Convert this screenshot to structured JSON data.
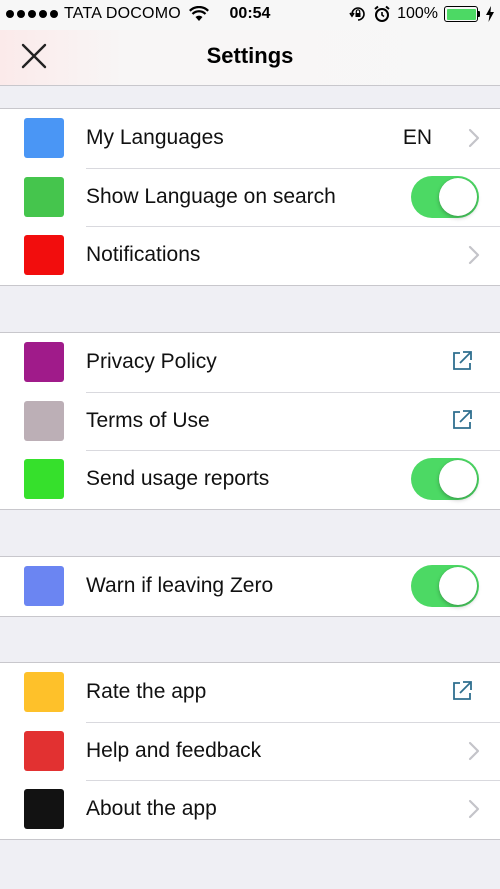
{
  "status_bar": {
    "carrier": "TATA DOCOMO",
    "time": "00:54",
    "battery": "100%",
    "battery_level": 1.0
  },
  "nav": {
    "title": "Settings"
  },
  "colors": {
    "toggle_on": "#4cd964",
    "link_icon": "#2f6f8f"
  },
  "groups": [
    {
      "items": [
        {
          "label": "My Languages",
          "color": "#4a96f5",
          "accessory": "chevron",
          "value": "EN"
        },
        {
          "label": "Show Language on search",
          "color": "#45c54d",
          "accessory": "toggle",
          "on": true
        },
        {
          "label": "Notifications",
          "color": "#f20d0d",
          "accessory": "chevron"
        }
      ]
    },
    {
      "items": [
        {
          "label": "Privacy Policy",
          "color": "#a01b8a",
          "accessory": "external-link-icon"
        },
        {
          "label": "Terms of Use",
          "color": "#bcafb6",
          "accessory": "external-link-icon"
        },
        {
          "label": "Send usage reports",
          "color": "#36e02c",
          "accessory": "toggle",
          "on": true
        }
      ]
    },
    {
      "items": [
        {
          "label": "Warn if leaving Zero",
          "color": "#6b85f2",
          "accessory": "toggle",
          "on": true
        }
      ]
    },
    {
      "items": [
        {
          "label": "Rate the app",
          "color": "#fec12a",
          "accessory": "external-link-icon"
        },
        {
          "label": "Help and feedback",
          "color": "#e23131",
          "accessory": "chevron"
        },
        {
          "label": "About the app",
          "color": "#121212",
          "accessory": "chevron"
        }
      ]
    }
  ]
}
